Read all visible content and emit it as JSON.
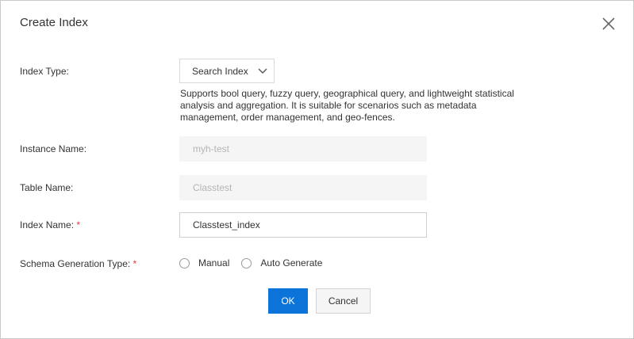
{
  "dialog": {
    "title": "Create Index",
    "close_icon": "close-icon"
  },
  "form": {
    "index_type": {
      "label": "Index Type:",
      "value": "Search Index",
      "help": "Supports bool query, fuzzy query, geographical query, and lightweight statistical analysis and aggregation. It is suitable for scenarios such as metadata management, order management, and geo-fences."
    },
    "instance_name": {
      "label": "Instance Name:",
      "value": "myh-test"
    },
    "table_name": {
      "label": "Table Name:",
      "value": "Classtest"
    },
    "index_name": {
      "label": "Index Name:",
      "required_mark": "*",
      "value": "Classtest_index"
    },
    "schema_generation_type": {
      "label": "Schema Generation Type:",
      "required_mark": "*",
      "options": [
        "Manual",
        "Auto Generate"
      ]
    }
  },
  "actions": {
    "ok_label": "OK",
    "cancel_label": "Cancel"
  },
  "colors": {
    "primary": "#0c73d9",
    "required": "#e4393c",
    "disabled_bg": "#f5f5f5"
  }
}
